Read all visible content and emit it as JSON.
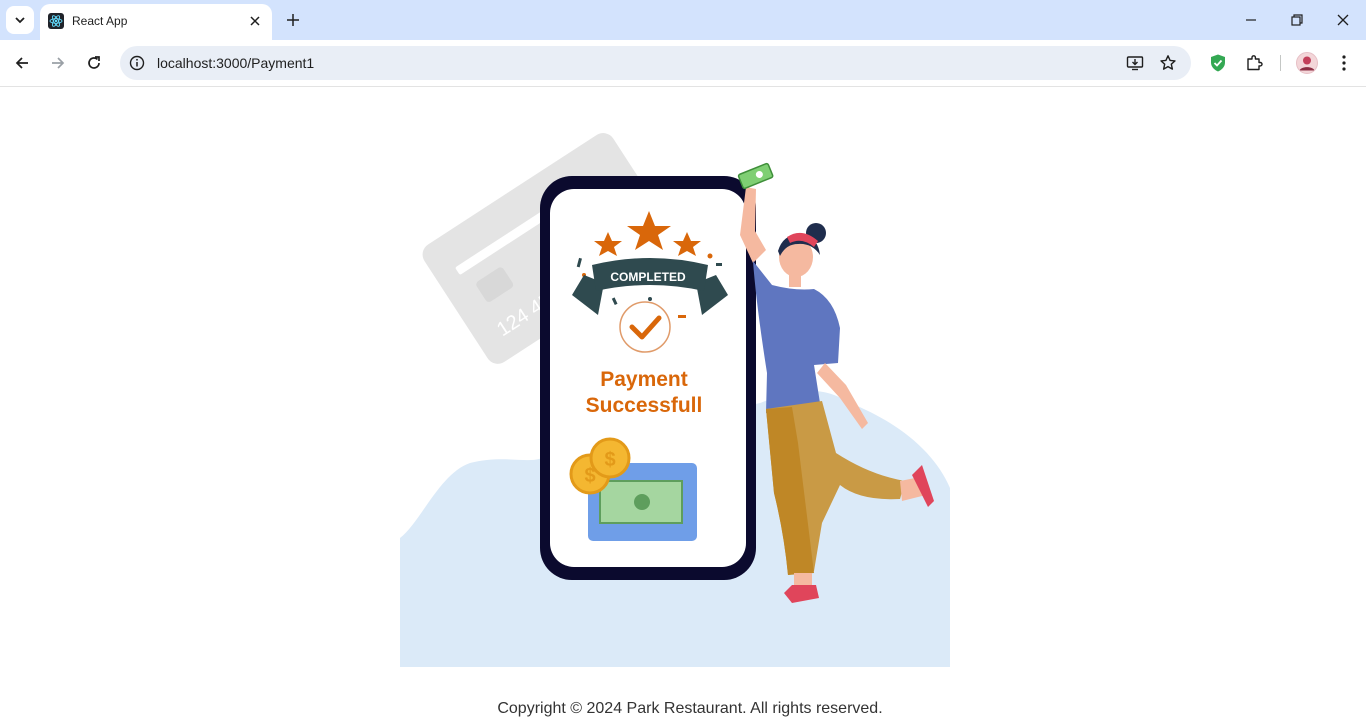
{
  "browser": {
    "tab": {
      "title": "React App",
      "favicon": "react-logo-icon"
    },
    "url": "localhost:3000/Payment1",
    "icons": {
      "tab_search": "chevron-down-icon",
      "tab_close": "close-icon",
      "new_tab": "plus-icon",
      "back": "arrow-left-icon",
      "forward": "arrow-right-icon",
      "reload": "reload-icon",
      "site_info": "info-icon",
      "install": "install-app-icon",
      "bookmark": "star-icon",
      "extension_shield": "shield-check-icon",
      "extensions": "puzzle-icon",
      "profile": "avatar",
      "menu": "kebab-menu-icon",
      "minimize": "minimize-icon",
      "restore": "restore-icon",
      "close_window": "close-icon"
    },
    "colors": {
      "tabstrip": "#d3e3fd",
      "omnibox": "#e9eef6"
    }
  },
  "page": {
    "illustration": {
      "banner_text": "COMPLETED",
      "headline_line1": "Payment",
      "headline_line2": "Successfull",
      "card_number_fragment": "124 456",
      "colors": {
        "accent": "#d9670a",
        "banner": "#2f4a4f",
        "phone_frame": "#0b0a2e",
        "blob": "#dbeaf8"
      }
    },
    "footer": "Copyright © 2024 Park Restaurant. All rights reserved."
  }
}
